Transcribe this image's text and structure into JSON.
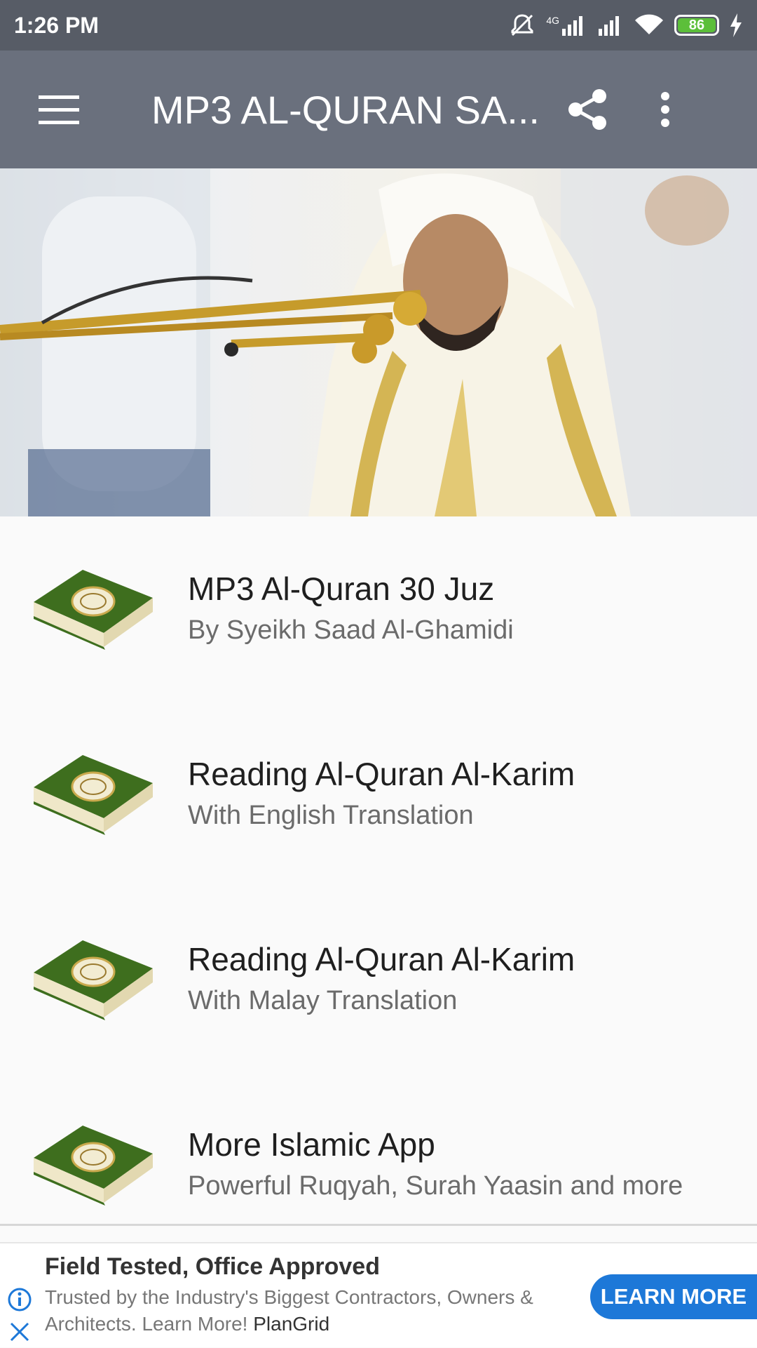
{
  "status_bar": {
    "time": "1:26 PM",
    "network_label": "4G",
    "battery_level": "86"
  },
  "app_bar": {
    "title": "MP3 AL-QURAN SA..."
  },
  "menu": {
    "items": [
      {
        "title": "MP3 Al-Quran 30 Juz",
        "subtitle": "By Syeikh Saad Al-Ghamidi"
      },
      {
        "title": "Reading Al-Quran Al-Karim",
        "subtitle": "With English Translation"
      },
      {
        "title": "Reading Al-Quran Al-Karim",
        "subtitle": "With Malay Translation"
      },
      {
        "title": "More Islamic App",
        "subtitle": "Powerful Ruqyah, Surah Yaasin and more"
      }
    ]
  },
  "ad": {
    "headline": "Field Tested, Office Approved",
    "body": "Trusted by the Industry's Biggest Contractors, Owners & Architects. Learn More!",
    "advertiser": "PlanGrid",
    "cta": "LEARN MORE"
  },
  "colors": {
    "status_bar": "#575c66",
    "app_bar": "#6a707d",
    "ad_cta": "#1d78d8",
    "book_green": "#3e6e1e"
  }
}
